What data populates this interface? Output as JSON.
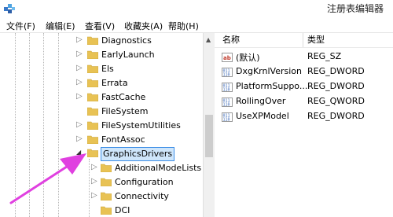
{
  "window": {
    "title": "注册表编辑器",
    "app_icon": "registry-editor-icon"
  },
  "menu": [
    "文件(F)",
    "编辑(E)",
    "查看(V)",
    "收藏夹(A)",
    "帮助(H)"
  ],
  "tree": {
    "items": [
      {
        "label": "Diagnostics",
        "expander": "▷"
      },
      {
        "label": "EarlyLaunch",
        "expander": "▷"
      },
      {
        "label": "Els",
        "expander": "▷"
      },
      {
        "label": "Errata",
        "expander": "▷"
      },
      {
        "label": "FastCache",
        "expander": "▷"
      },
      {
        "label": "FileSystem",
        "expander": ""
      },
      {
        "label": "FileSystemUtilities",
        "expander": "▷"
      },
      {
        "label": "FontAssoc",
        "expander": "▷"
      },
      {
        "label": "GraphicsDrivers",
        "expander": "◢",
        "selected": true
      }
    ],
    "children": [
      {
        "label": "AdditionalModeLists",
        "expander": "▷"
      },
      {
        "label": "Configuration",
        "expander": "▷"
      },
      {
        "label": "Connectivity",
        "expander": "▷"
      },
      {
        "label": "DCI",
        "expander": ""
      }
    ]
  },
  "values": {
    "columns": {
      "name": "名称",
      "type": "类型"
    },
    "rows": [
      {
        "name": "(默认)",
        "type": "REG_SZ",
        "icon": "string-value-icon"
      },
      {
        "name": "DxgKrnlVersion",
        "type": "REG_DWORD",
        "icon": "binary-value-icon"
      },
      {
        "name": "PlatformSuppo...",
        "type": "REG_DWORD",
        "icon": "binary-value-icon"
      },
      {
        "name": "RollingOver",
        "type": "REG_QWORD",
        "icon": "binary-value-icon"
      },
      {
        "name": "UseXPModel",
        "type": "REG_DWORD",
        "icon": "binary-value-icon"
      }
    ]
  },
  "colors": {
    "folder": "#e8c254",
    "selection": "#cfe6fb",
    "arrow": "#e040e0",
    "icon_red": "#c0392b",
    "icon_blue": "#3564b5"
  }
}
